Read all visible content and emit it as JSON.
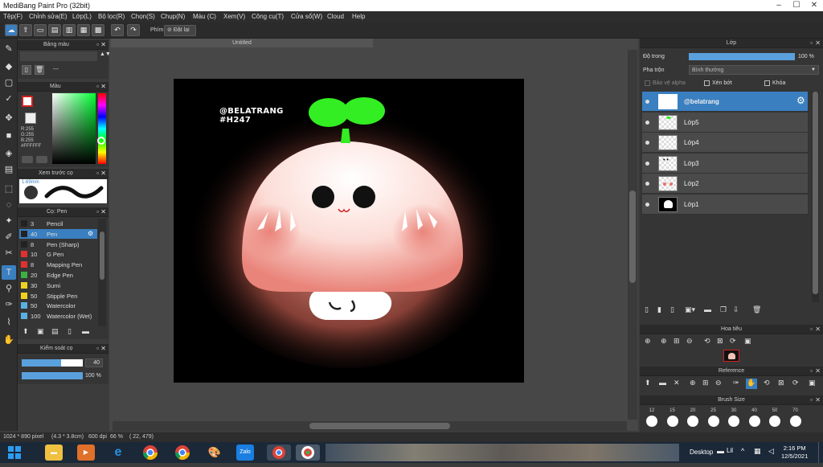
{
  "window": {
    "title": "MediBang Paint Pro (32bit)"
  },
  "menu": [
    "Tệp(F)",
    "Chỉnh sửa(E)",
    "Lớp(L)",
    "Bộ lọc(R)",
    "Chọn(S)",
    "Chụp(N)",
    "Màu (C)",
    "Xem(V)",
    "Công cụ(T)",
    "Cửa sổ(W)",
    "Cloud",
    "Help"
  ],
  "toolbar": {
    "key_label": "Phím",
    "reset_label": "Đặt lại"
  },
  "document": {
    "tab_title": "Untitled"
  },
  "artwork": {
    "watermark_line1": "@BELATRANG",
    "watermark_line2": "#H247"
  },
  "left_panels": {
    "palette": {
      "title": "Bảng màu",
      "dash": "---"
    },
    "color": {
      "title": "Màu",
      "r": "R:255",
      "g": "G:255",
      "b": "B:255",
      "hex": "#FFFFFF"
    },
    "brush_preview": {
      "title": "Xem trước cọ",
      "size": "1.69mm"
    },
    "brush": {
      "title": "Cọ: Pen",
      "items": [
        {
          "size": "3",
          "name": "Pencil",
          "color": "#222222"
        },
        {
          "size": "40",
          "name": "Pen",
          "color": "#222222",
          "selected": true
        },
        {
          "size": "8",
          "name": "Pen (Sharp)",
          "color": "#222222"
        },
        {
          "size": "10",
          "name": "G Pen",
          "color": "#e03030"
        },
        {
          "size": "8",
          "name": "Mapping Pen",
          "color": "#e03030"
        },
        {
          "size": "20",
          "name": "Edge Pen",
          "color": "#3cb043"
        },
        {
          "size": "30",
          "name": "Sumi",
          "color": "#f0d020"
        },
        {
          "size": "50",
          "name": "Stipple Pen",
          "color": "#f0d020"
        },
        {
          "size": "50",
          "name": "Watercolor",
          "color": "#5ab0e0"
        },
        {
          "size": "100",
          "name": "Watercolor (Wet)",
          "color": "#5ab0e0"
        }
      ]
    },
    "brush_control": {
      "title": "Kiểm soát cọ",
      "size_value": "40",
      "opacity_value": "100 %",
      "size_fraction": 0.65,
      "opacity_fraction": 1.0
    }
  },
  "layer_panel": {
    "title": "Lớp",
    "opacity_label": "Độ trong",
    "opacity_value": "100 %",
    "opacity_fraction": 1.0,
    "blend_label": "Pha trộn",
    "blend_value": "Bình thường",
    "protect_alpha": "Bảo vệ alpha",
    "clipping": "Xén bớt",
    "lock": "Khóa",
    "layers": [
      {
        "name": "@belatrang",
        "selected": true
      },
      {
        "name": "Lớp5"
      },
      {
        "name": "Lớp4"
      },
      {
        "name": "Lớp3"
      },
      {
        "name": "Lớp2"
      },
      {
        "name": "Lớp1"
      }
    ]
  },
  "navigator": {
    "title": "Hoa tiêu"
  },
  "reference": {
    "title": "Reference"
  },
  "brush_size": {
    "title": "Brush Size",
    "sizes": [
      "12",
      "15",
      "20",
      "25",
      "30",
      "40",
      "50",
      "70"
    ]
  },
  "status": {
    "dims": "1024 * 890 pixel",
    "cm": "(4.3 * 3.8cm)",
    "dpi": "600 dpi",
    "zoom": "66 %",
    "coords": "( 22, 479)"
  },
  "taskbar": {
    "desktop": "Desktop",
    "time": "2:16 PM",
    "date": "12/5/2021",
    "zalo": "Zalo",
    "lang": "Lil"
  }
}
